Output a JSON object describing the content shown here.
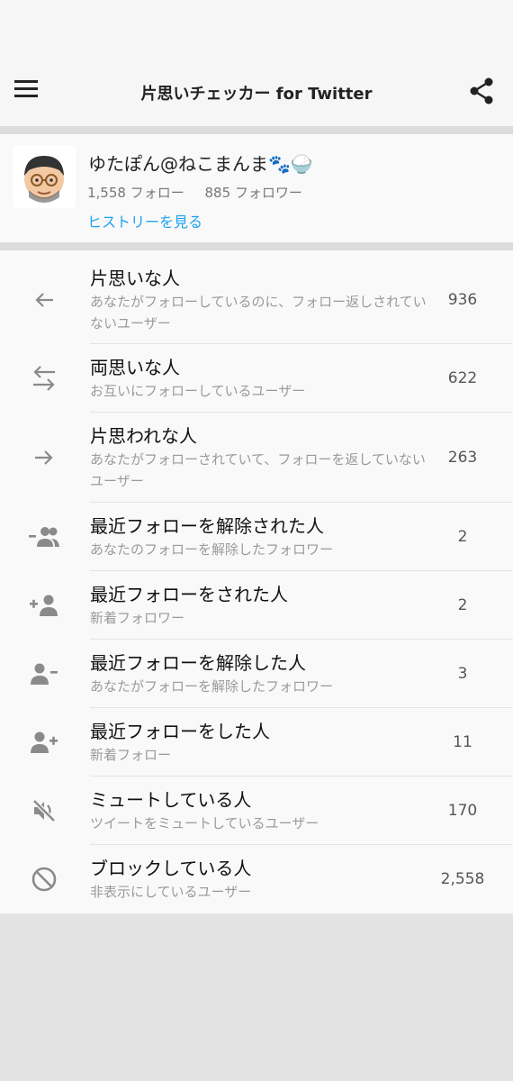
{
  "app": {
    "title": "片思いチェッカー for Twitter",
    "menu_icon": "hamburger-menu-icon",
    "share_icon": "share-icon"
  },
  "profile": {
    "name": "ゆたぽん@ねこまんま🐾🍚",
    "following": "1,558 フォロー",
    "followers": "885 フォロワー",
    "history_link": "ヒストリーを見る",
    "accent_color": "#1da1f2"
  },
  "items": [
    {
      "label": "片思いな人",
      "sub": "あなたがフォローしているのに、フォロー返しされていないユーザー",
      "count": "936",
      "icon": "arrow-left-icon"
    },
    {
      "label": "両思いな人",
      "sub": "お互いにフォローしているユーザー",
      "count": "622",
      "icon": "swap-arrows-icon"
    },
    {
      "label": "片思われな人",
      "sub": "あなたがフォローされていて、フォローを返していないユーザー",
      "count": "263",
      "icon": "arrow-right-icon"
    },
    {
      "label": "最近フォローを解除された人",
      "sub": "あなたのフォローを解除したフォロワー",
      "count": "2",
      "icon": "group-remove-icon"
    },
    {
      "label": "最近フォローをされた人",
      "sub": "新着フォロワー",
      "count": "2",
      "icon": "person-add-left-icon"
    },
    {
      "label": "最近フォローを解除した人",
      "sub": "あなたがフォローを解除したフォロワー",
      "count": "3",
      "icon": "person-remove-icon"
    },
    {
      "label": "最近フォローをした人",
      "sub": "新着フォロー",
      "count": "11",
      "icon": "person-add-icon"
    },
    {
      "label": "ミュートしている人",
      "sub": "ツイートをミュートしているユーザー",
      "count": "170",
      "icon": "mute-icon"
    },
    {
      "label": "ブロックしている人",
      "sub": "非表示にしているユーザー",
      "count": "2,558",
      "icon": "block-icon"
    }
  ]
}
